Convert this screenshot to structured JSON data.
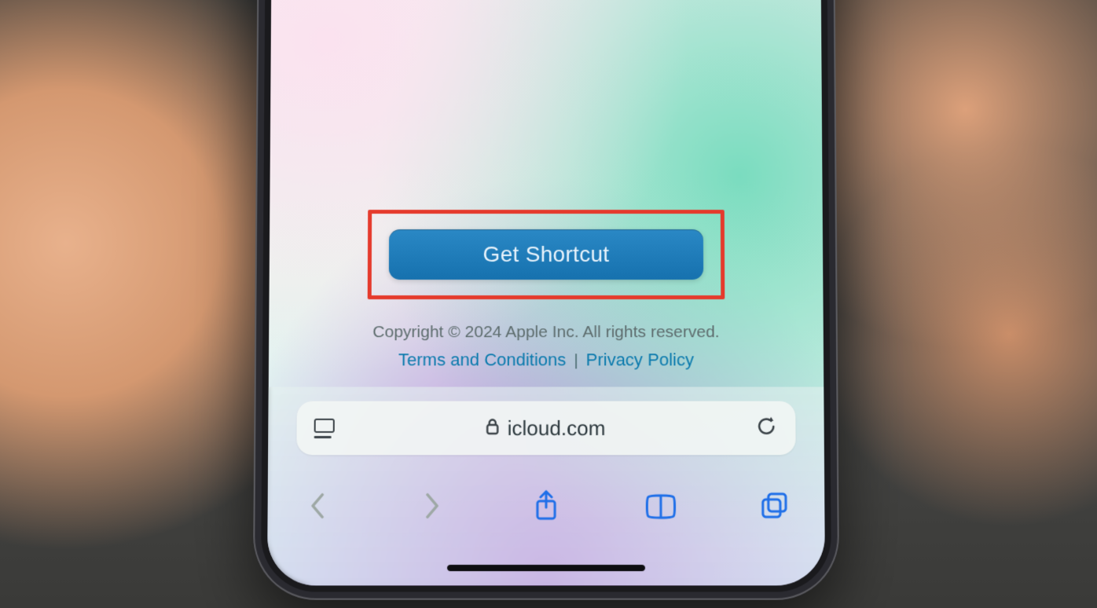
{
  "page": {
    "cta_label": "Get Shortcut",
    "copyright": "Copyright © 2024 Apple Inc. All rights reserved.",
    "terms_label": "Terms and Conditions",
    "privacy_label": "Privacy Policy"
  },
  "browser": {
    "domain": "icloud.com"
  },
  "annotation": {
    "highlight_color": "#e53a2c"
  }
}
